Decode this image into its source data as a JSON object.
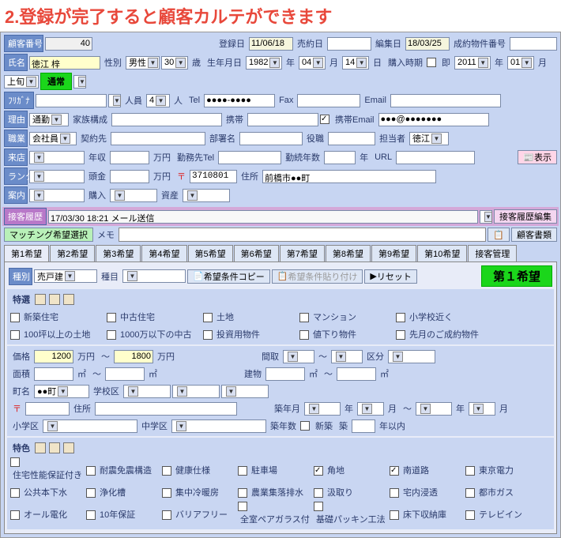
{
  "title": "2.登録が完了すると顧客カルテができます",
  "top": {
    "custno_lbl": "顧客番号",
    "custno": "40",
    "regdate_lbl": "登録日",
    "regdate": "11/06/18",
    "closedate_lbl": "売約日",
    "closedate": "",
    "editdate_lbl": "編集日",
    "editdate": "18/03/25",
    "contractno_lbl": "成約物件番号",
    "contractno": ""
  },
  "r1": {
    "name_lbl": "氏名",
    "name": "徳江 梓",
    "sex_lbl": "性別",
    "sex": "男性",
    "age": "30",
    "age_u": "歳",
    "bday_lbl": "生年月日",
    "y": "1982",
    "m": "04",
    "d": "14",
    "buy_lbl": "購入時期",
    "soku": "即",
    "y2": "2011",
    "y2u": "年",
    "m2": "01",
    "m2u": "月",
    "period": "上旬",
    "status": "通常"
  },
  "r2": {
    "furi_lbl": "ﾌﾘｶﾞﾅ",
    "furi": "",
    "ppl_lbl": "人員",
    "ppl": "4",
    "ppl_u": "人",
    "tel_lbl": "Tel",
    "tel": "●●●●-●●●●",
    "fax_lbl": "Fax",
    "fax": "",
    "email_lbl": "Email",
    "email": ""
  },
  "r3": {
    "reason_lbl": "理由",
    "reason": "通勤",
    "family_lbl": "家族構成",
    "family": "",
    "mob_lbl": "携帯",
    "mob": "",
    "memail_lbl": "携帯Email",
    "memail": "●●●@●●●●●●●"
  },
  "r4": {
    "job_lbl": "職業",
    "job": "会社員",
    "work_lbl": "契約先",
    "work": "",
    "dept_lbl": "部署名",
    "dept": "",
    "pos_lbl": "役職",
    "pos": "",
    "staff_lbl": "担当者",
    "staff": "徳江"
  },
  "r5": {
    "visit_lbl": "来店",
    "visit": "",
    "income_lbl": "年収",
    "income": "",
    "man": "万円",
    "wtel_lbl": "勤務先Tel",
    "wtel": "",
    "wyrs_lbl": "勤続年数",
    "wyrs": "",
    "yr": "年",
    "url_lbl": "URL",
    "url": "",
    "show": "表示"
  },
  "r6": {
    "rank_lbl": "ランク",
    "rank": "",
    "cap_lbl": "頭金",
    "cap": "",
    "man": "万円",
    "zip_lbl": "〒",
    "zip": "3710801",
    "addr_lbl": "住所",
    "addr": "前橋市●●町"
  },
  "r7": {
    "guide_lbl": "案内",
    "guide": "",
    "buy_lbl": "購入",
    "buy": "",
    "asset_lbl": "資産",
    "asset": ""
  },
  "hist": {
    "hdr": "接客履歴",
    "val": "17/03/30 18:21 メール送信",
    "edit": "接客履歴編集"
  },
  "match": {
    "btn": "マッチング希望選択",
    "memo_lbl": "メモ",
    "docs": "顧客書類"
  },
  "tabs": [
    "第1希望",
    "第2希望",
    "第3希望",
    "第4希望",
    "第5希望",
    "第6希望",
    "第7希望",
    "第8希望",
    "第9希望",
    "第10希望",
    "接客管理"
  ],
  "wish": {
    "type_lbl": "種別",
    "type": "売戸建",
    "item_lbl": "種目",
    "item": "",
    "copy": "希望条件コピー",
    "paste": "希望条件貼り付け",
    "reset": "リセット",
    "badge": "第１希望",
    "feat_lbl": "特選",
    "cbs1": [
      "新築住宅",
      "中古住宅",
      "土地",
      "マンション",
      "小学校近く"
    ],
    "cbs2": [
      "100坪以上の土地",
      "1000万以下の中古",
      "投資用物件",
      "値下り物件",
      "先月のご成約物件"
    ],
    "price_lbl": "価格",
    "p1": "1200",
    "p2": "1800",
    "man": "万円",
    "tilde": "～",
    "layout_lbl": "間取",
    "kubun_lbl": "区分",
    "area_lbl": "面積",
    "m2": "㎡",
    "bldg_lbl": "建物",
    "town_lbl": "町名",
    "town": "●●町",
    "school_lbl": "学校区",
    "zip_lbl": "〒",
    "addr_lbl": "住所",
    "byear_lbl": "築年月",
    "y": "年",
    "m": "月",
    "elem_lbl": "小学区",
    "mid_lbl": "中学区",
    "byrs_lbl": "築年数",
    "new": "新築",
    "chiku": "築",
    "within": "年以内",
    "tokushoku_lbl": "特色",
    "grid": [
      [
        "住宅性能保証付き",
        "耐震免震構造",
        "健康仕様",
        "駐車場",
        "角地:1",
        "南道路:1",
        "東京電力"
      ],
      [
        "公共本下水",
        "浄化槽",
        "集中冷暖房",
        "農業集落排水",
        "汲取り",
        "宅内浸透",
        "都市ガス"
      ],
      [
        "オール電化",
        "10年保証",
        "バリアフリー",
        "全室ペアガラス付",
        "基礎パッキン工法",
        "床下収納庫",
        "テレビイン"
      ]
    ]
  }
}
